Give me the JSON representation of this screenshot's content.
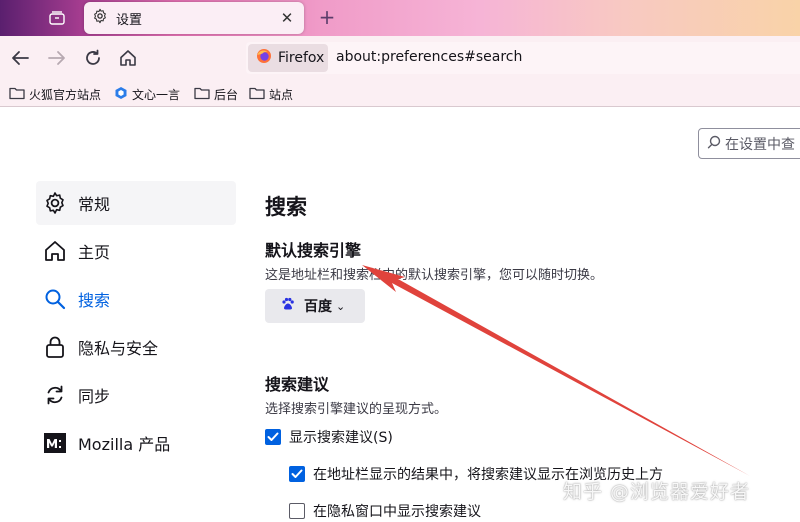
{
  "tabbar": {
    "tab_title": "设置",
    "tab_icon": "gear-icon",
    "close_icon": "close-icon",
    "new_tab_icon": "plus-icon"
  },
  "navbar": {
    "identity_label": "Firefox",
    "url": "about:preferences#search"
  },
  "bookmarks": [
    {
      "label": "火狐官方站点",
      "icon": "folder-icon"
    },
    {
      "label": "文心一言",
      "icon": "ernie-icon"
    },
    {
      "label": "后台",
      "icon": "folder-icon"
    },
    {
      "label": "站点",
      "icon": "folder-icon"
    }
  ],
  "search": {
    "placeholder": "在设置中查"
  },
  "sidebar": {
    "items": [
      {
        "label": "常规",
        "icon": "gear-icon"
      },
      {
        "label": "主页",
        "icon": "home-icon"
      },
      {
        "label": "搜索",
        "icon": "search-icon"
      },
      {
        "label": "隐私与安全",
        "icon": "lock-icon"
      },
      {
        "label": "同步",
        "icon": "sync-icon"
      },
      {
        "label": "Mozilla 产品",
        "icon": "mozilla-icon"
      }
    ]
  },
  "main": {
    "title": "搜索",
    "default_engine": {
      "heading": "默认搜索引擎",
      "description": "这是地址栏和搜索栏中的默认搜索引擎，您可以随时切换。",
      "selected": "百度"
    },
    "suggestions": {
      "heading": "搜索建议",
      "description": "选择搜索引擎建议的呈现方式。",
      "options": [
        {
          "label": "显示搜索建议(S)",
          "checked": true
        },
        {
          "label": "在地址栏显示的结果中，将搜索建议显示在浏览历史上方",
          "checked": true
        },
        {
          "label": "在隐私窗口中显示搜索建议",
          "checked": false
        }
      ]
    }
  },
  "watermark": "知乎 @浏览器爱好者",
  "colors": {
    "accent": "#0061e0",
    "annotation_arrow": "#e0433c"
  }
}
